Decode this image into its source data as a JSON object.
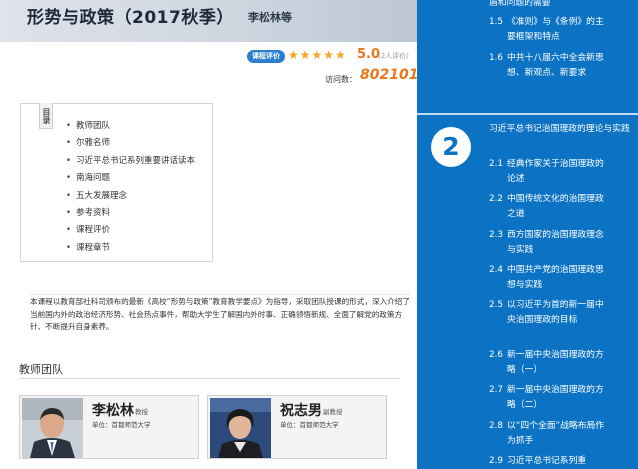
{
  "course": {
    "title": "形势与政策（2017秋季）",
    "author": "李松林等"
  },
  "rating": {
    "badge": "课程评价",
    "stars": "★★★★★",
    "score": "5.0",
    "count": "(2人评价)"
  },
  "visits": {
    "label": "访问数：",
    "value": "802101"
  },
  "toc": {
    "tab": "目录",
    "items": [
      "教师团队",
      "尔雅名师",
      "习近平总书记系列重要讲话读本",
      "南海问题",
      "五大发展理念",
      "参考资料",
      "课程评价",
      "课程章节"
    ]
  },
  "description": "本课程以教育部社科司颁布的最新《高校“形势与政策”教育教学要点》为指导，采取团队授课的形式，深入介绍了当前国内外的政治经济形势、社会热点事件，帮助大学生了解国内外时事、正确领悟新规、全面了解党的政策方针、不断提升自身素养。",
  "teachers_section": {
    "title": "教师团队",
    "teachers": [
      {
        "name": "李松林",
        "title": "教授",
        "unit": "单位：首都师范大学"
      },
      {
        "name": "祝志男",
        "title": "副教授",
        "unit": "单位：首都师范大学"
      }
    ]
  },
  "sidebar": {
    "top_partial": "盾和问题的需要",
    "items_before": [
      {
        "num": "1.5",
        "text": "《准则》与《条例》的主要框架和特点"
      },
      {
        "num": "1.6",
        "text": "中共十八届六中全会新思想、新观点、新要求"
      }
    ],
    "chapter": {
      "number": "2",
      "title": "习近平总书记治国理政的理论与实践"
    },
    "items": [
      {
        "num": "2.1",
        "text": "经典作家关于治国理政的论述"
      },
      {
        "num": "2.2",
        "text": "中国传统文化的治国理政之道"
      },
      {
        "num": "2.3",
        "text": "西方国家的治国理政理念与实践"
      },
      {
        "num": "2.4",
        "text": "中国共产党的治国理政思想与实践"
      },
      {
        "num": "2.5",
        "text": "以习近平为首的新一届中央治国理政的目标"
      },
      {
        "num": "2.6",
        "text": "新一届中央治国理政的方略（一）"
      },
      {
        "num": "2.7",
        "text": "新一届中央治国理政的方略（二）"
      },
      {
        "num": "2.8",
        "text": "以“四个全面”战略布局作为抓手"
      },
      {
        "num": "2.9",
        "text": "习近平总书记系列重"
      }
    ]
  },
  "colors": {
    "sidebar_bg": "#0c73c4",
    "accent_orange": "#e8781a",
    "badge_blue": "#2b7fd1",
    "star_gold": "#f5a623"
  }
}
